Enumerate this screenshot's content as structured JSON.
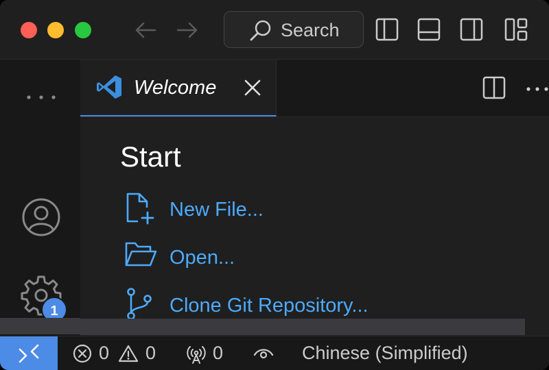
{
  "titlebar": {
    "search_label": "Search"
  },
  "tab": {
    "label": "Welcome"
  },
  "welcome": {
    "title": "Start",
    "items": [
      {
        "label": "New File...",
        "icon": "new-file-icon"
      },
      {
        "label": "Open...",
        "icon": "folder-open-icon"
      },
      {
        "label": "Clone Git Repository...",
        "icon": "git-branch-icon"
      }
    ]
  },
  "activitybar": {
    "settings_badge": "1"
  },
  "statusbar": {
    "errors": "0",
    "warnings": "0",
    "ports": "0",
    "language": "Chinese (Simplified)"
  },
  "colors": {
    "accent": "#4c8be6",
    "link": "#4daafc",
    "background": "#1f1f1f",
    "close_button": "#ff5f57",
    "minimize_button": "#febc2e",
    "maximize_button": "#28c840"
  }
}
